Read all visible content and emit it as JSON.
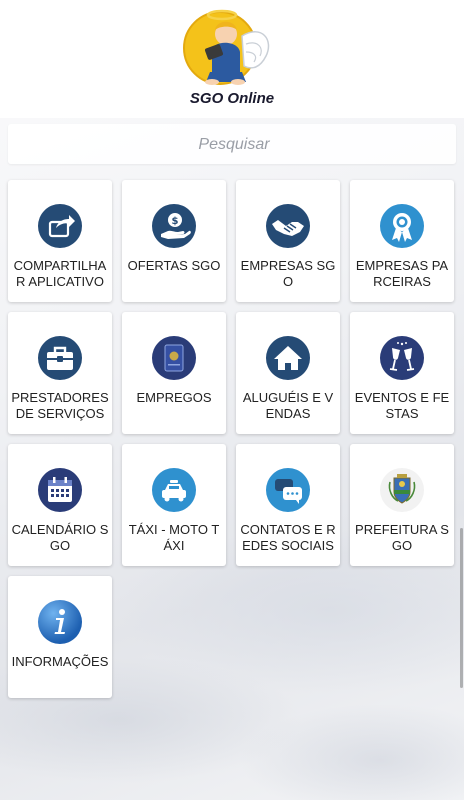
{
  "app": {
    "title": "SGO Online"
  },
  "search": {
    "placeholder": "Pesquisar"
  },
  "tiles": [
    {
      "label": "COMPARTILHAR APLICATIVO",
      "icon": "share-icon"
    },
    {
      "label": "OFERTAS SGO",
      "icon": "money-hand-icon"
    },
    {
      "label": "EMPRESAS SGO",
      "icon": "handshake-icon"
    },
    {
      "label": "EMPRESAS PARCEIRAS",
      "icon": "award-ribbon-icon"
    },
    {
      "label": "PRESTADORES DE SERVIÇOS",
      "icon": "toolbox-icon"
    },
    {
      "label": "EMPREGOS",
      "icon": "work-card-icon"
    },
    {
      "label": "ALUGUÉIS E VENDAS",
      "icon": "house-icon"
    },
    {
      "label": "EVENTOS E FESTAS",
      "icon": "toast-glasses-icon"
    },
    {
      "label": "CALENDÁRIO SGO",
      "icon": "calendar-icon"
    },
    {
      "label": "TÁXI - MOTO TÁXI",
      "icon": "taxi-icon"
    },
    {
      "label": "CONTATOS E REDES SOCIAIS",
      "icon": "chat-bubbles-icon"
    },
    {
      "label": "PREFEITURA SGO",
      "icon": "city-crest-icon"
    },
    {
      "label": "INFORMAÇÕES",
      "icon": "info-icon"
    }
  ],
  "colors": {
    "icon_dark": "#254b75",
    "icon_light": "#2f91cf",
    "icon_navy": "#2a3c78",
    "logo_yellow": "#f4c21a"
  }
}
